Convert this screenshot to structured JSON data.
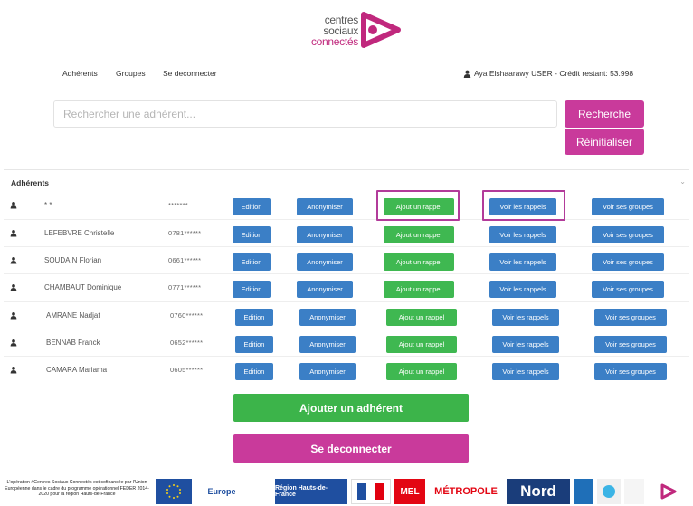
{
  "brand": {
    "line1": "centres",
    "line2": "sociaux",
    "line3": "connectés",
    "color_pink": "#c0287d",
    "color_grey": "#555555"
  },
  "nav": {
    "adherents": "Adhérents",
    "groupes": "Groupes",
    "logout": "Se deconnecter",
    "user_info": "Aya Elshaarawy USER - Crédit restant: 53.998"
  },
  "search": {
    "placeholder": "Rechercher une adhérent...",
    "search_label": "Recherche",
    "reset_label": "Réinitialiser"
  },
  "panel": {
    "title": "Adhérents"
  },
  "actions": {
    "edit": "Edition",
    "anonymize": "Anonymiser",
    "add_reminder": "Ajout un rappel",
    "view_reminders": "Voir les rappels",
    "view_groups": "Voir ses groupes"
  },
  "members": [
    {
      "name": "* *",
      "phone": "*******"
    },
    {
      "name": "LEFEBVRE Christelle",
      "phone": "0781******"
    },
    {
      "name": "SOUDAIN Florian",
      "phone": "0661******"
    },
    {
      "name": "CHAMBAUT Dominique",
      "phone": "0771******"
    },
    {
      "name": "AMRANE Nadjat",
      "phone": "0760******"
    },
    {
      "name": "BENNAB Franck",
      "phone": "0652******"
    },
    {
      "name": "CAMARA Mariama",
      "phone": "0605******"
    }
  ],
  "buttons": {
    "add_member": "Ajouter un adhérent",
    "logout": "Se deconnecter"
  },
  "footer": {
    "text": "L'opération #Centres Sociaux Connectés est cofinancée par l'Union Européenne dans le cadre du programme opérationnel FEDER 2014-2020 pour la région Hauts-de-France",
    "logos": [
      "Europe",
      "Région Hauts-de-France",
      "MEL",
      "MÉTROPOLE",
      "Nord"
    ]
  },
  "colors": {
    "primary_blue": "#3b7fc6",
    "success_green": "#3fb851",
    "accent_pink": "#c93a9b"
  }
}
